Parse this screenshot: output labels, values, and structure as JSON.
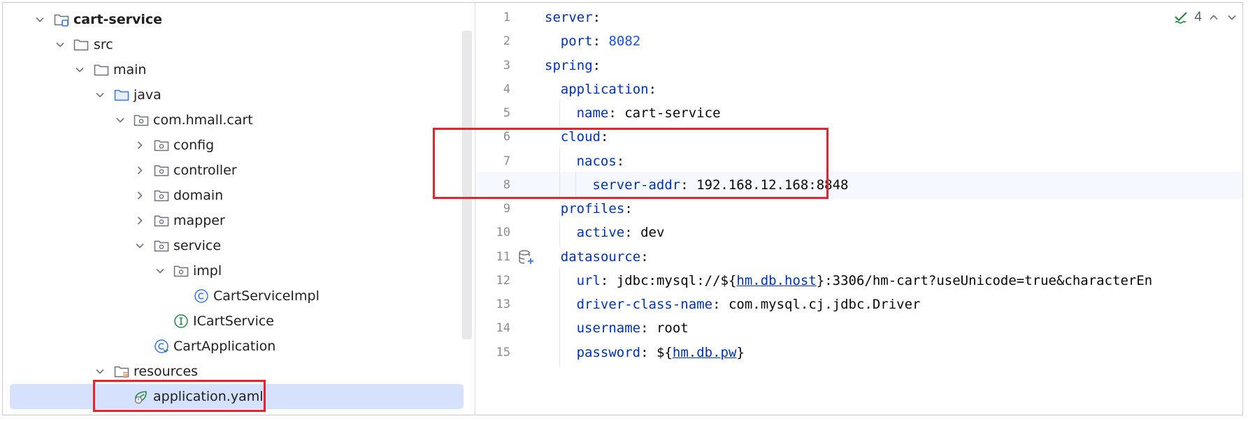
{
  "tree": {
    "items": [
      {
        "label": "cart-service",
        "bold": true,
        "icon": "module-folder-icon",
        "expanded": true
      },
      {
        "label": "src",
        "icon": "folder-icon",
        "expanded": true
      },
      {
        "label": "main",
        "icon": "folder-icon",
        "expanded": true
      },
      {
        "label": "java",
        "icon": "source-root-folder-icon",
        "expanded": true
      },
      {
        "label": "com.hmall.cart",
        "icon": "package-icon",
        "expanded": true
      },
      {
        "label": "config",
        "icon": "package-icon",
        "expanded": false
      },
      {
        "label": "controller",
        "icon": "package-icon",
        "expanded": false
      },
      {
        "label": "domain",
        "icon": "package-icon",
        "expanded": false
      },
      {
        "label": "mapper",
        "icon": "package-icon",
        "expanded": false
      },
      {
        "label": "service",
        "icon": "package-icon",
        "expanded": true
      },
      {
        "label": "impl",
        "icon": "package-icon",
        "expanded": true
      },
      {
        "label": "CartServiceImpl",
        "icon": "class-icon"
      },
      {
        "label": "ICartService",
        "icon": "interface-icon"
      },
      {
        "label": "CartApplication",
        "icon": "spring-boot-class-icon"
      },
      {
        "label": "resources",
        "icon": "resources-folder-icon",
        "expanded": true
      },
      {
        "label": "application.yaml",
        "icon": "spring-yaml-icon",
        "selected": true
      }
    ]
  },
  "editor": {
    "inspection_count": "4",
    "lines": [
      {
        "n": "1",
        "tokens": [
          {
            "t": "server",
            "c": "k"
          },
          {
            "t": ":"
          }
        ]
      },
      {
        "n": "2",
        "tokens": [
          {
            "t": "port",
            "c": "k"
          },
          {
            "t": ": "
          },
          {
            "t": "8082",
            "c": "n"
          }
        ]
      },
      {
        "n": "3",
        "tokens": [
          {
            "t": "spring",
            "c": "k"
          },
          {
            "t": ":"
          }
        ]
      },
      {
        "n": "4",
        "tokens": [
          {
            "t": "application",
            "c": "k"
          },
          {
            "t": ":"
          }
        ]
      },
      {
        "n": "5",
        "tokens": [
          {
            "t": "name",
            "c": "k"
          },
          {
            "t": ": cart-service"
          }
        ]
      },
      {
        "n": "6",
        "tokens": [
          {
            "t": "cloud",
            "c": "k"
          },
          {
            "t": ":"
          }
        ]
      },
      {
        "n": "7",
        "tokens": [
          {
            "t": "nacos",
            "c": "k"
          },
          {
            "t": ":"
          }
        ]
      },
      {
        "n": "8",
        "tokens": [
          {
            "t": "server-addr",
            "c": "k"
          },
          {
            "t": ": 192.168.12.168:8848"
          }
        ]
      },
      {
        "n": "9",
        "tokens": [
          {
            "t": "profiles",
            "c": "k"
          },
          {
            "t": ":"
          }
        ]
      },
      {
        "n": "10",
        "tokens": [
          {
            "t": "active",
            "c": "k"
          },
          {
            "t": ": dev"
          }
        ]
      },
      {
        "n": "11",
        "tokens": [
          {
            "t": "datasource",
            "c": "k"
          },
          {
            "t": ":"
          }
        ]
      },
      {
        "n": "12",
        "tokens": [
          {
            "t": "url",
            "c": "k"
          },
          {
            "t": ": jdbc:mysql://${"
          },
          {
            "t": "hm.db.host",
            "c": "lnk"
          },
          {
            "t": "}:3306/hm-cart?useUnicode=true&characterEn"
          }
        ]
      },
      {
        "n": "13",
        "tokens": [
          {
            "t": "driver-class-name",
            "c": "k"
          },
          {
            "t": ": com.mysql.cj.jdbc.Driver"
          }
        ]
      },
      {
        "n": "14",
        "tokens": [
          {
            "t": "username",
            "c": "k"
          },
          {
            "t": ": root"
          }
        ]
      },
      {
        "n": "15",
        "tokens": [
          {
            "t": "password",
            "c": "k"
          },
          {
            "t": ": ${"
          },
          {
            "t": "hm.db.pw",
            "c": "lnk"
          },
          {
            "t": "}"
          }
        ]
      }
    ]
  },
  "colors": {
    "highlight": "#e8232c",
    "selection": "#d5e1fd",
    "yaml_key": "#0033b3",
    "yaml_number": "#1750eb"
  }
}
